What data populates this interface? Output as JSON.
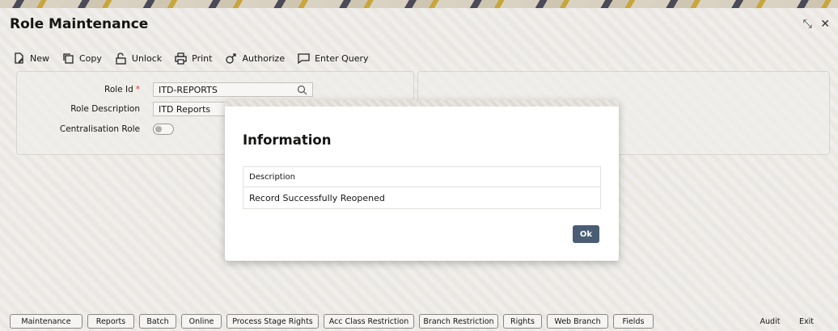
{
  "window": {
    "title": "Role Maintenance",
    "controls": [
      "⤡",
      "✕"
    ]
  },
  "toolbar": {
    "new": "New",
    "copy": "Copy",
    "unlock": "Unlock",
    "print": "Print",
    "authorize": "Authorize",
    "enter_query": "Enter Query"
  },
  "form": {
    "role_id_label": "Role Id",
    "required_mark": "*",
    "role_id_value": "ITD-REPORTS",
    "role_desc_label": "Role Description",
    "role_desc_value": "ITD Reports",
    "centralisation_label": "Centralisation Role"
  },
  "dialog": {
    "title": "Information",
    "column_header": "Description",
    "message": "Record Successfully Reopened",
    "ok_label": "Ok"
  },
  "bottom_tabs": [
    "Maintenance",
    "Reports",
    "Batch",
    "Online",
    "Process Stage Rights",
    "Acc Class Restriction",
    "Branch Restriction",
    "Rights",
    "Web Branch",
    "Fields"
  ],
  "bottom_actions": {
    "audit": "Audit",
    "exit": "Exit"
  }
}
